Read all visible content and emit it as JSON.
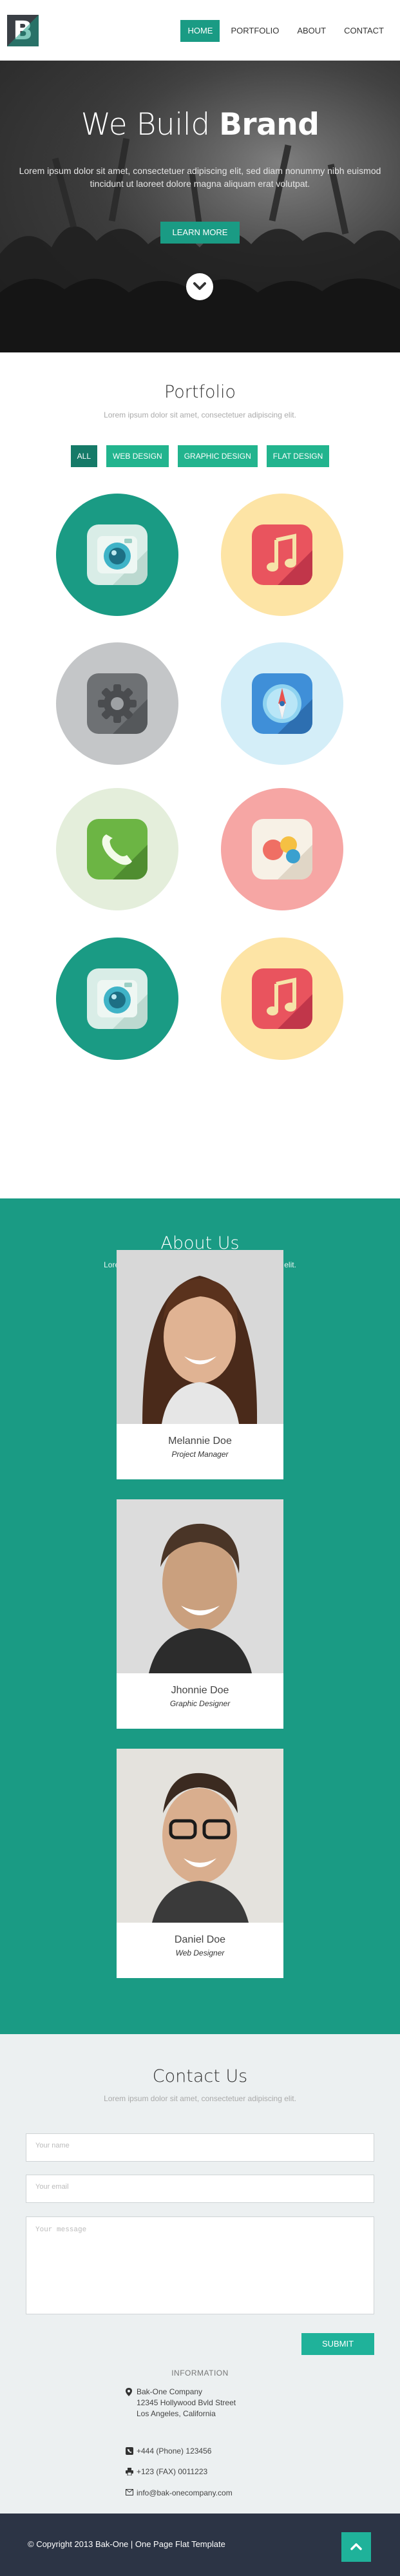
{
  "brand": {
    "logo_letter": "B"
  },
  "nav": {
    "items": [
      "HOME",
      "PORTFOLIO",
      "ABOUT",
      "CONTACT"
    ],
    "active": "HOME"
  },
  "hero": {
    "title_light": "We Build ",
    "title_bold": "Brand",
    "text": "Lorem ipsum dolor sit amet, consectetuer adipiscing elit, sed diam nonummy nibh euismod tincidunt ut laoreet dolore magna aliquam erat volutpat.",
    "button": "LEARN MORE",
    "scroll_icon": "chevron-down-icon"
  },
  "portfolio": {
    "title": "Portfolio",
    "subtitle": "Lorem ipsum dolor sit amet, consectetuer adipiscing elit.",
    "filters": [
      "ALL",
      "WEB DESIGN",
      "GRAPHIC DESIGN",
      "FLAT DESIGN"
    ],
    "active_filter": "ALL",
    "items": [
      {
        "icon": "camera-icon",
        "circle_color": "#1a9b84"
      },
      {
        "icon": "music-icon",
        "circle_color": "#fde4a5"
      },
      {
        "icon": "settings-gear-icon",
        "circle_color": "#c4c6c8"
      },
      {
        "icon": "compass-icon",
        "circle_color": "#d4eef8"
      },
      {
        "icon": "phone-icon",
        "circle_color": "#e4eedb"
      },
      {
        "icon": "chat-bubbles-icon",
        "circle_color": "#f6a6a4"
      },
      {
        "icon": "camera-icon",
        "circle_color": "#1a9b84"
      },
      {
        "icon": "music-icon",
        "circle_color": "#fde4a5"
      }
    ]
  },
  "about": {
    "title": "About Us",
    "subtitle": "Lorem ipsum dolor sit amet, consectetuer adipiscing elit.",
    "team": [
      {
        "name": "Melannie Doe",
        "role": "Project Manager"
      },
      {
        "name": "Jhonnie Doe",
        "role": "Graphic Designer"
      },
      {
        "name": "Daniel Doe",
        "role": "Web Designer"
      }
    ]
  },
  "contact": {
    "title": "Contact Us",
    "subtitle": "Lorem ipsum dolor sit amet, consectetuer adipiscing elit.",
    "name_placeholder": "Your name",
    "email_placeholder": "Your email",
    "message_placeholder": "Your message",
    "submit": "SUBMIT",
    "info_title": "INFORMATION",
    "company": "Bak-One Company",
    "street": "12345 Hollywood Bvld Street",
    "city": "Los Angeles, California",
    "phone": "+444 (Phone) 123456",
    "fax": "+123 (FAX) 0011223",
    "email": "info@bak-onecompany.com"
  },
  "footer": {
    "copyright": "© Copyright 2013 Bak-One | One Page Flat Template"
  },
  "colors": {
    "accent": "#1a9b84",
    "footer": "#2c3445",
    "contact_bg": "#ecf0f1"
  }
}
